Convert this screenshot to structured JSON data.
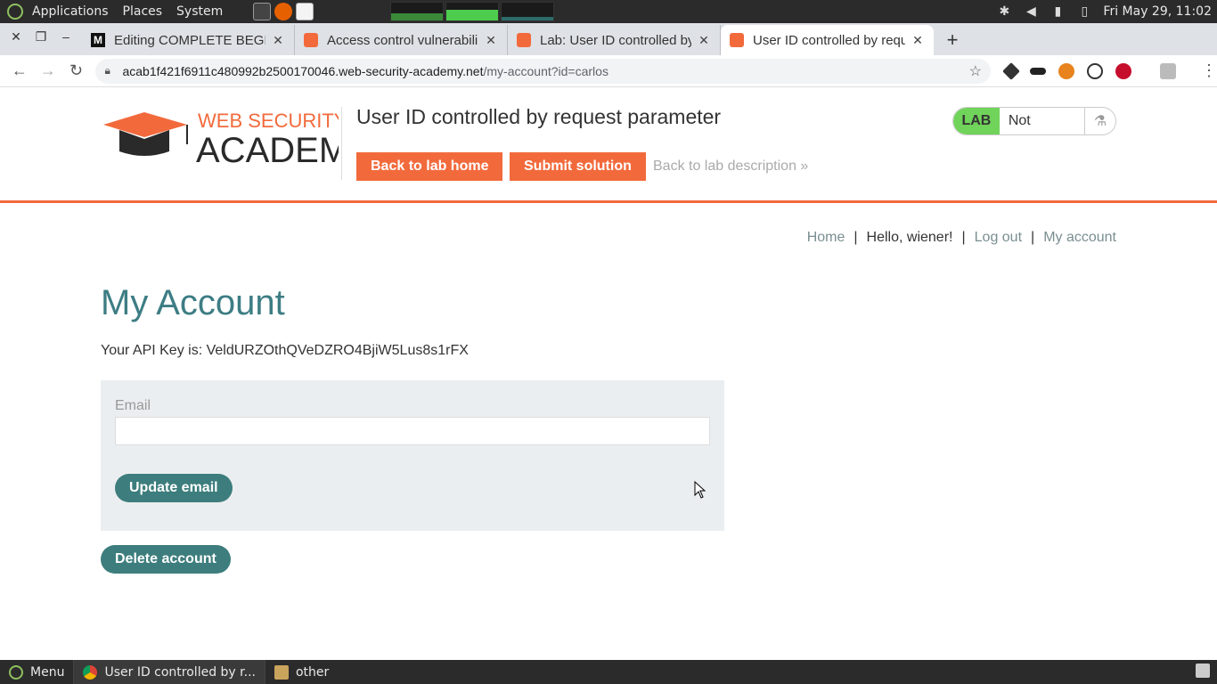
{
  "system": {
    "menus": [
      "Applications",
      "Places",
      "System"
    ],
    "clock": "Fri May 29, 11:02"
  },
  "window_controls": [
    "close",
    "restore",
    "minimize"
  ],
  "tabs": [
    {
      "title": "Editing COMPLETE BEGI",
      "favicon": "medium-icon",
      "active": false
    },
    {
      "title": "Access control vulnerabili",
      "favicon": "portswigger-icon",
      "active": false
    },
    {
      "title": "Lab: User ID controlled by",
      "favicon": "portswigger-icon",
      "active": false
    },
    {
      "title": "User ID controlled by requ",
      "favicon": "portswigger-icon",
      "active": true
    }
  ],
  "address": {
    "host": "acab1f421f6911c480992b2500170046.web-security-academy.net",
    "path": "/my-account?id=carlos"
  },
  "lab": {
    "title": "User ID controlled by request parameter",
    "back_label": "Back to lab home",
    "submit_label": "Submit solution",
    "desc_label": "Back to lab description »",
    "badge": "LAB",
    "status": "Not solved",
    "logo_top": "WEB SECURITY",
    "logo_bottom": "ACADEMY"
  },
  "nav": {
    "home": "Home",
    "hello": "Hello, wiener!",
    "logout": "Log out",
    "account": "My account",
    "sep": "|"
  },
  "page": {
    "title": "My Account",
    "api_key": "Your API Key is: VeldURZOthQVeDZRO4BjiW5Lus8s1rFX",
    "email_label": "Email",
    "email_value": "",
    "update_label": "Update email",
    "delete_label": "Delete account"
  },
  "taskbar": {
    "menu": "Menu",
    "task1": "User ID controlled by r...",
    "task2": "other"
  },
  "colors": {
    "accent_orange": "#f26a3c",
    "accent_teal": "#3d7d7d",
    "lab_green": "#70d35a"
  }
}
